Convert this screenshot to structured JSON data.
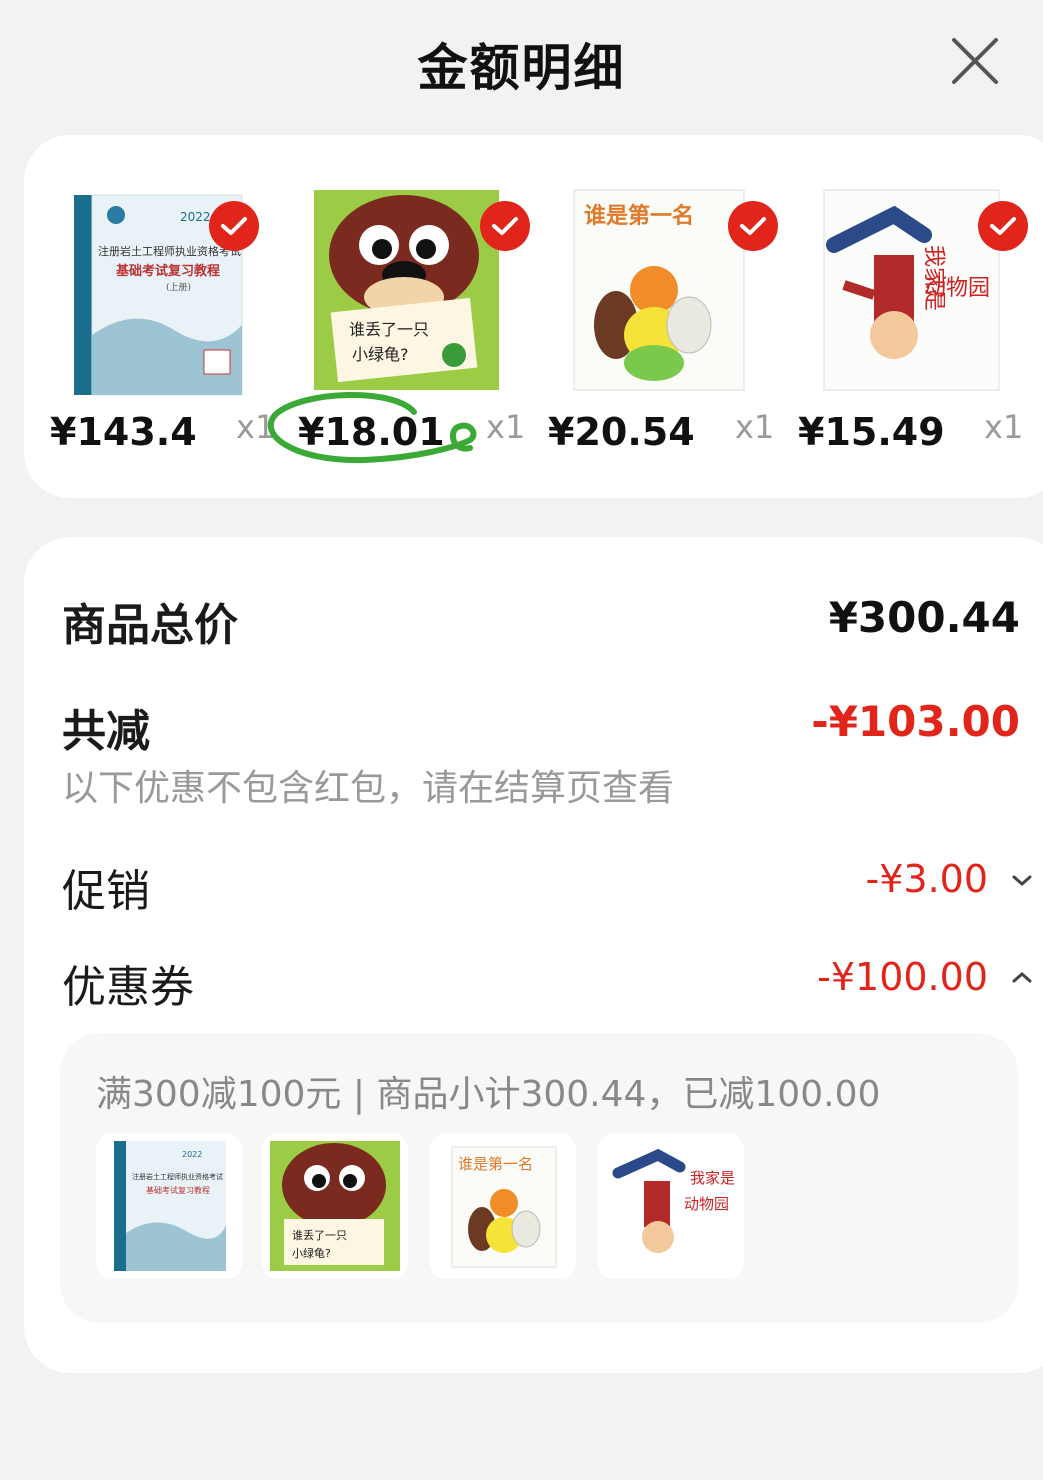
{
  "header": {
    "title": "金额明细",
    "close_icon": "close-icon"
  },
  "products": [
    {
      "price": "¥143.4",
      "qty": "x1",
      "checked": true,
      "cover": "exam-textbook-cover",
      "cover_text": [
        "2022",
        "注册岩土工程师执业资格考试",
        "基础考试复习教程",
        "(上册)"
      ]
    },
    {
      "price": "¥18.01",
      "qty": "x1",
      "checked": true,
      "cover": "dog-picture-book-cover",
      "annotated": true,
      "cover_text": [
        "谁丢了一只",
        "小绿龟?"
      ]
    },
    {
      "price": "¥20.54",
      "qty": "x1",
      "checked": true,
      "cover": "who-is-first-picture-book-cover",
      "cover_text": [
        "谁是第一名"
      ]
    },
    {
      "price": "¥15.49",
      "qty": "x1",
      "checked": true,
      "cover": "my-home-is-zoo-picture-book-cover",
      "cover_text": [
        "我家是",
        "动物园"
      ]
    }
  ],
  "summary": {
    "total_label": "商品总价",
    "total_value": "¥300.44",
    "discount_label": "共减",
    "discount_value": "-¥103.00",
    "note": "以下优惠不包含红包，请在结算页查看",
    "promo_label": "促销",
    "promo_value": "-¥3.00",
    "coupon_label": "优惠券",
    "coupon_value": "-¥100.00",
    "coupon_detail": "满300减100元 | 商品小计300.44，已减100.00"
  },
  "colors": {
    "accent_red": "#e1251b",
    "annotation_green": "#3aa935"
  }
}
